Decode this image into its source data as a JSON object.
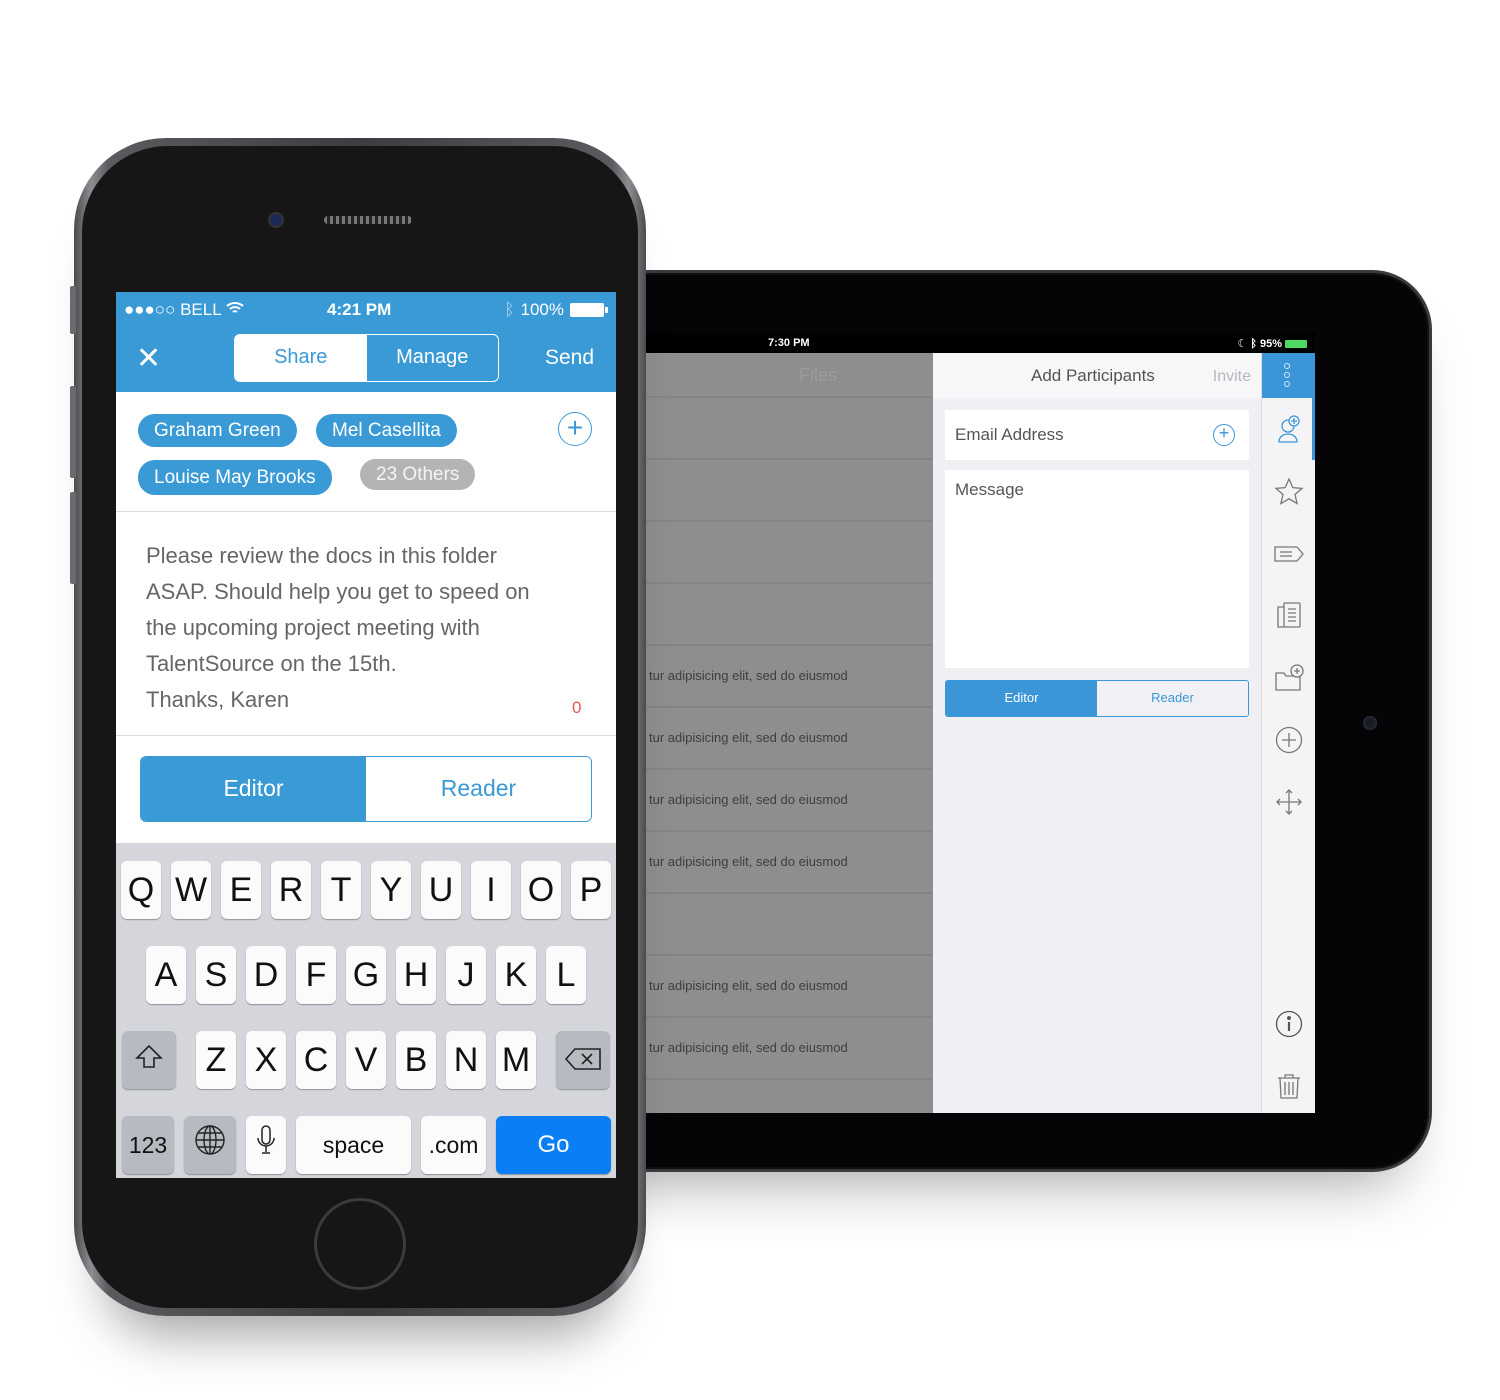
{
  "iphone": {
    "status_bar": {
      "carrier": "●●●○○ BELL",
      "time": "4:21 PM",
      "battery": "100%",
      "icons": [
        "wifi-icon",
        "bluetooth-icon",
        "battery-icon"
      ]
    },
    "nav": {
      "close_icon": "✕",
      "tabs": [
        {
          "label": "Share",
          "active": true
        },
        {
          "label": "Manage",
          "active": false
        }
      ],
      "send_label": "Send"
    },
    "recipients": {
      "chips": [
        {
          "label": "Graham Green"
        },
        {
          "label": "Mel Casellita"
        },
        {
          "label": "Louise May Brooks"
        }
      ],
      "others_label": "23 Others",
      "add_icon": "+"
    },
    "message": {
      "text": "Please review the docs in this folder\nASAP. Should help you get to speed on\nthe upcoming project meeting with\nTalentSource on the 15th.\nThanks, Karen",
      "char_count": "0"
    },
    "role": {
      "options": [
        {
          "label": "Editor",
          "active": true
        },
        {
          "label": "Reader",
          "active": false
        }
      ]
    },
    "keyboard": {
      "row1": [
        "Q",
        "W",
        "E",
        "R",
        "T",
        "Y",
        "U",
        "I",
        "O",
        "P"
      ],
      "row2": [
        "A",
        "S",
        "D",
        "F",
        "G",
        "H",
        "J",
        "K",
        "L"
      ],
      "row3": [
        "Z",
        "X",
        "C",
        "V",
        "B",
        "N",
        "M"
      ],
      "shift_icon": "⇧",
      "delete_icon": "⌫",
      "numbers_label": "123",
      "globe_icon": "🌐",
      "mic_icon": "🎙",
      "space_label": "space",
      "dotcom_label": ".com",
      "go_label": "Go"
    }
  },
  "ipad": {
    "status_bar": {
      "time": "7:30 PM",
      "battery": "95%"
    },
    "files": {
      "title": "Files",
      "rows": [
        {
          "text": ""
        },
        {
          "text": ""
        },
        {
          "text": ""
        },
        {
          "text": ""
        },
        {
          "text": "tur adipisicing elit, sed do eiusmod"
        },
        {
          "text": "tur adipisicing elit, sed do eiusmod"
        },
        {
          "text": "tur adipisicing elit, sed do eiusmod"
        },
        {
          "text": "tur adipisicing elit, sed do eiusmod"
        },
        {
          "text": ""
        },
        {
          "text": "tur adipisicing elit, sed do eiusmod"
        },
        {
          "text": "tur adipisicing elit, sed do eiusmod"
        }
      ]
    },
    "participants": {
      "title": "Add Participants",
      "invite_label": "Invite",
      "email_placeholder": "Email Address",
      "message_placeholder": "Message",
      "role_options": [
        {
          "label": "Editor",
          "active": true
        },
        {
          "label": "Reader",
          "active": false
        }
      ]
    },
    "sidebar": {
      "icons": [
        "more-icon",
        "add-person-icon",
        "star-icon",
        "tag-icon",
        "document-icon",
        "new-folder-icon",
        "add-circle-icon",
        "move-icon",
        "info-icon",
        "trash-icon"
      ]
    }
  },
  "colors": {
    "accent": "#3a9ad6",
    "keyboard_go": "#0a7ff5",
    "counter": "#e05a4d",
    "chip_grey": "#b4b4b4"
  }
}
